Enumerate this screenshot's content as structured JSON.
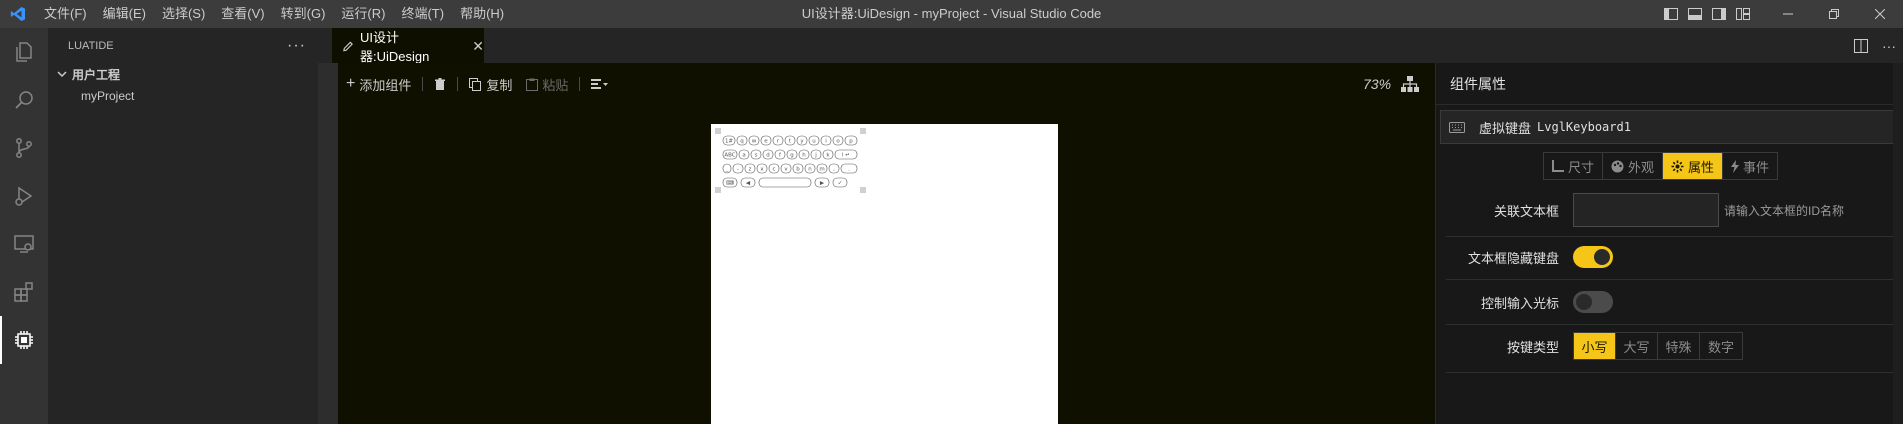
{
  "window": {
    "title": "UI设计器:UiDesign - myProject - Visual Studio Code",
    "menu": [
      "文件(F)",
      "编辑(E)",
      "选择(S)",
      "查看(V)",
      "转到(G)",
      "运行(R)",
      "终端(T)",
      "帮助(H)"
    ]
  },
  "sidebar": {
    "header": "LUATIDE",
    "root_label": "用户工程",
    "project_label": "myProject"
  },
  "editor": {
    "tab_label": "UI设计器:UiDesign"
  },
  "toolbar": {
    "add_label": "添加组件",
    "copy_label": "复制",
    "paste_label": "粘贴",
    "zoom": "73%"
  },
  "props": {
    "title": "组件属性",
    "component_type": "虚拟键盘",
    "component_id": "LvglKeyboard1",
    "tabs": [
      "尺寸",
      "外观",
      "属性",
      "事件"
    ],
    "active_tab": "属性",
    "linked_textbox_label": "关联文本框",
    "linked_textbox_hint": "请输入文本框的ID名称",
    "hide_keyboard_label": "文本框隐藏键盘",
    "hide_keyboard_on": true,
    "cursor_label": "控制输入光标",
    "cursor_on": false,
    "key_type_label": "按键类型",
    "key_types": [
      "小写",
      "大写",
      "特殊",
      "数字"
    ],
    "active_key_type": "小写"
  },
  "colors": {
    "accent": "#f5c518",
    "editor_bg": "#101000",
    "vsc_blue": "#3794ff"
  }
}
